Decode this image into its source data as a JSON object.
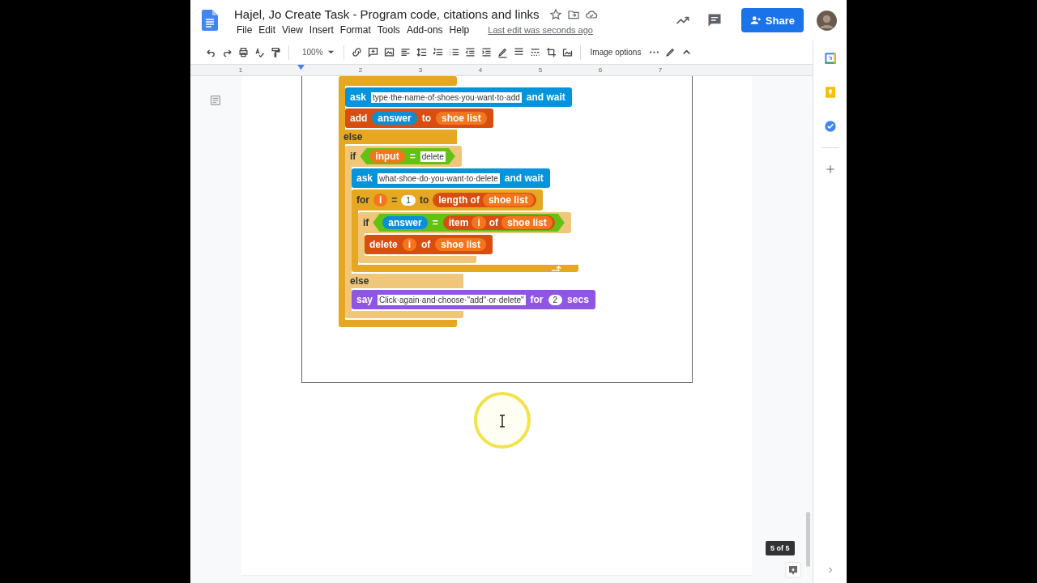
{
  "document": {
    "title": "Hajel, Jo Create Task - Program code, citations and links",
    "menu": [
      "File",
      "Edit",
      "View",
      "Insert",
      "Format",
      "Tools",
      "Add-ons",
      "Help"
    ],
    "last_edit": "Last edit was seconds ago"
  },
  "share_button": "Share",
  "toolbar": {
    "zoom": "100%",
    "image_options": "Image options"
  },
  "ruler": [
    "1",
    "2",
    "3",
    "4",
    "5",
    "6",
    "7"
  ],
  "script": [
    {
      "kind": "if",
      "color": "#e6a822",
      "children": [
        {
          "kind": "command",
          "color": "#0494dc",
          "parts": [
            {
              "kind": "word",
              "text": "ask"
            },
            {
              "kind": "slot",
              "text": "type·the·name·of·shoes·you·want·to·add"
            },
            {
              "kind": "word",
              "text": "and wait"
            }
          ]
        },
        {
          "kind": "command",
          "color": "#d94d11",
          "parts": [
            {
              "kind": "word",
              "text": "add"
            },
            {
              "kind": "var",
              "color": "#0a8fd4",
              "text": "answer"
            },
            {
              "kind": "word",
              "text": "to"
            },
            {
              "kind": "var",
              "color": "#f3761d",
              "text": "shoe list"
            }
          ]
        }
      ],
      "else_label": "else",
      "else_children": [
        {
          "kind": "if",
          "color": "#f0c77a",
          "head": [
            {
              "kind": "word",
              "text": "if"
            },
            {
              "kind": "predicate",
              "color": "#62c213",
              "parts": [
                {
                  "kind": "var",
                  "color": "#f3761d",
                  "text": "input"
                },
                {
                  "kind": "word",
                  "text": "="
                },
                {
                  "kind": "slot",
                  "text": "delete"
                }
              ]
            }
          ],
          "children": [
            {
              "kind": "command",
              "color": "#0494dc",
              "parts": [
                {
                  "kind": "word",
                  "text": "ask"
                },
                {
                  "kind": "slot",
                  "text": "what·shoe·do·you·want·to·delete"
                },
                {
                  "kind": "word",
                  "text": "and wait"
                }
              ]
            },
            {
              "kind": "loop",
              "color": "#e6a822",
              "head": [
                {
                  "kind": "word",
                  "text": "for"
                },
                {
                  "kind": "var",
                  "color": "#f3761d",
                  "text": "i"
                },
                {
                  "kind": "word",
                  "text": "="
                },
                {
                  "kind": "number",
                  "text": "1"
                },
                {
                  "kind": "word",
                  "text": "to"
                },
                {
                  "kind": "reporter",
                  "color": "#d94d11",
                  "parts": [
                    {
                      "kind": "word",
                      "text": "length of"
                    },
                    {
                      "kind": "var",
                      "color": "#f3761d",
                      "text": "shoe list"
                    }
                  ]
                }
              ],
              "children": [
                {
                  "kind": "if",
                  "color": "#f0c77a",
                  "head": [
                    {
                      "kind": "word",
                      "text": "if"
                    },
                    {
                      "kind": "predicate",
                      "color": "#62c213",
                      "parts": [
                        {
                          "kind": "var",
                          "color": "#0a8fd4",
                          "text": "answer"
                        },
                        {
                          "kind": "word",
                          "text": "="
                        },
                        {
                          "kind": "reporter",
                          "color": "#d94d11",
                          "parts": [
                            {
                              "kind": "word",
                              "text": "item"
                            },
                            {
                              "kind": "var",
                              "color": "#f3761d",
                              "text": "i"
                            },
                            {
                              "kind": "word",
                              "text": "of"
                            },
                            {
                              "kind": "var",
                              "color": "#f3761d",
                              "text": "shoe list"
                            }
                          ]
                        }
                      ]
                    }
                  ],
                  "children": [
                    {
                      "kind": "command",
                      "color": "#d94d11",
                      "parts": [
                        {
                          "kind": "word",
                          "text": "delete"
                        },
                        {
                          "kind": "var",
                          "color": "#f3761d",
                          "text": "i"
                        },
                        {
                          "kind": "word",
                          "text": "of"
                        },
                        {
                          "kind": "var",
                          "color": "#f3761d",
                          "text": "shoe list"
                        }
                      ]
                    }
                  ]
                }
              ]
            }
          ],
          "else_label": "else",
          "else_children": [
            {
              "kind": "command",
              "color": "#8f56e3",
              "parts": [
                {
                  "kind": "word",
                  "text": "say"
                },
                {
                  "kind": "slot",
                  "text": "Click·again·and·choose·\"add\"·or·delete\""
                },
                {
                  "kind": "word",
                  "text": "for"
                },
                {
                  "kind": "number",
                  "text": "2"
                },
                {
                  "kind": "word",
                  "text": "secs"
                }
              ]
            }
          ]
        }
      ]
    }
  ],
  "page_counter": "5 of 5"
}
